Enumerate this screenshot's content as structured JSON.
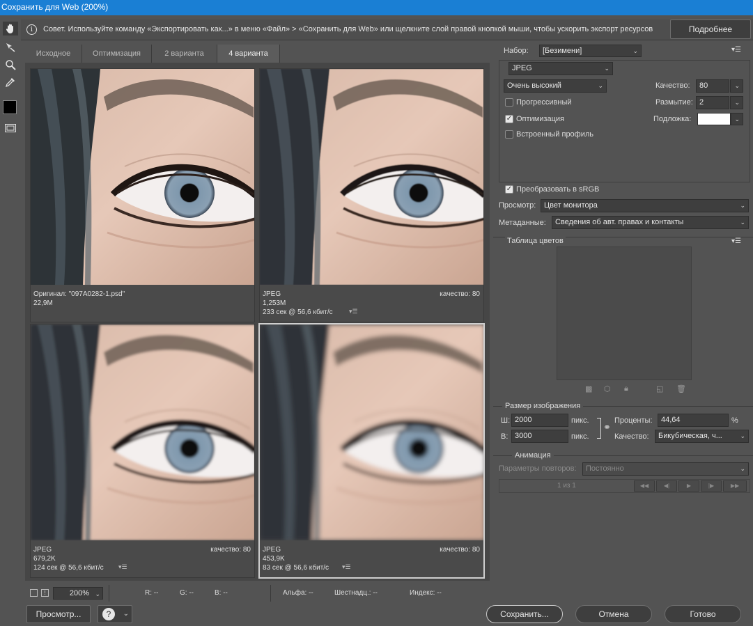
{
  "window": {
    "title": "Сохранить для Web (200%)"
  },
  "tip": {
    "text": "Совет. Используйте команду «Экспортировать как...» в меню «Файл» > «Сохранить для Web» или щелкните слой правой кнопкой мыши, чтобы ускорить экспорт ресурсов",
    "more_button": "Подробнее"
  },
  "tools": [
    "hand-icon",
    "slice-select-icon",
    "zoom-icon",
    "eyedropper-icon",
    "eyedropper-color-swatch",
    "toggle-slices-icon"
  ],
  "tabs": [
    {
      "label": "Исходное"
    },
    {
      "label": "Оптимизация"
    },
    {
      "label": "2 варианта"
    },
    {
      "label": "4 варианта",
      "active": true
    }
  ],
  "panes": [
    {
      "line1": "Оригинал: \"097A0282-1.psd\"",
      "line2": "22,9M",
      "line3": "",
      "quality": "",
      "blur": 0
    },
    {
      "line1": "JPEG",
      "line2": "1,253M",
      "line3": "233 сек @ 56,6 кбит/с",
      "quality": "качество: 80",
      "blur": 0.3
    },
    {
      "line1": "JPEG",
      "line2": "679,2K",
      "line3": "124 сек @ 56,6 кбит/с",
      "quality": "качество: 80",
      "blur": 1.6
    },
    {
      "line1": "JPEG",
      "line2": "453,9K",
      "line3": "83 сек @ 56,6 кбит/с",
      "quality": "качество: 80",
      "blur": 3.2
    }
  ],
  "status": {
    "zoom": "200%",
    "r": "R: --",
    "g": "G: --",
    "b": "B: --",
    "alpha": "Альфа: --",
    "hex": "Шестнадц.: --",
    "index": "Индекс: --"
  },
  "settings": {
    "preset_label": "Набор:",
    "preset_value": "[Безимени]",
    "format": "JPEG",
    "quality_level": "Очень высокий",
    "quality_label": "Качество:",
    "quality_value": "80",
    "blur_label": "Размытие:",
    "blur_value": "2",
    "matte_label": "Подложка:",
    "progressive": "Прогрессивный",
    "optimized": "Оптимизация",
    "embed_profile": "Встроенный профиль",
    "convert_srgb": "Преобразовать в sRGB",
    "preview_label": "Просмотр:",
    "preview_value": "Цвет монитора",
    "metadata_label": "Метаданные:",
    "metadata_value": "Сведения об авт. правах и контакты"
  },
  "color_table": {
    "title": "Таблица цветов"
  },
  "image_size": {
    "title": "Размер изображения",
    "w_label": "Ш:",
    "w_value": "2000",
    "h_label": "В:",
    "h_value": "3000",
    "unit": "пикс.",
    "percent_label": "Проценты:",
    "percent_value": "44,64",
    "percent_unit": "%",
    "quality_label": "Качество:",
    "quality_value": "Бикубическая, ч..."
  },
  "animation": {
    "title": "Анимация",
    "loop_label": "Параметры повторов:",
    "loop_value": "Постоянно",
    "frame": "1 из 1"
  },
  "footer": {
    "preview": "Просмотр...",
    "save": "Сохранить...",
    "cancel": "Отмена",
    "done": "Готово"
  },
  "colors": {
    "title_bar": "#1a7fd4",
    "panel": "#535353",
    "view": "#464646"
  }
}
